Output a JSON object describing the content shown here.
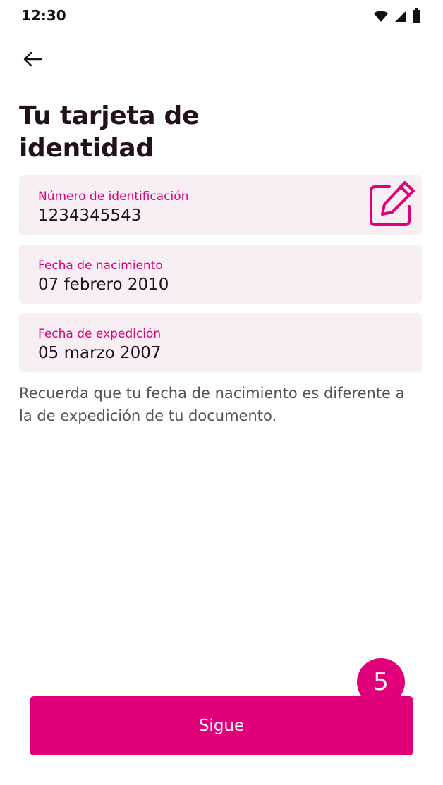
{
  "status_bar": {
    "time": "12:30",
    "icons": [
      "wifi-icon",
      "signal-icon",
      "battery-icon"
    ]
  },
  "header": {
    "back_icon": "arrow-left-icon",
    "title": "Tu tarjeta de identidad"
  },
  "fields": [
    {
      "label": "Número de identificación",
      "value": "1234345543",
      "action_icon": "edit-icon"
    },
    {
      "label": "Fecha de nacimiento",
      "value": "07 febrero 2010"
    },
    {
      "label": "Fecha de expedición",
      "value": "05 marzo 2007"
    }
  ],
  "helper_text": "Recuerda que tu fecha de nacimiento es diferente a la de expedición de tu documento.",
  "footer": {
    "step_badge": "5",
    "primary_button_label": "Sigue"
  },
  "colors": {
    "accent": "#e0007a",
    "field_background": "#f7eff4",
    "title": "#22101f",
    "helper_text": "#565256"
  }
}
